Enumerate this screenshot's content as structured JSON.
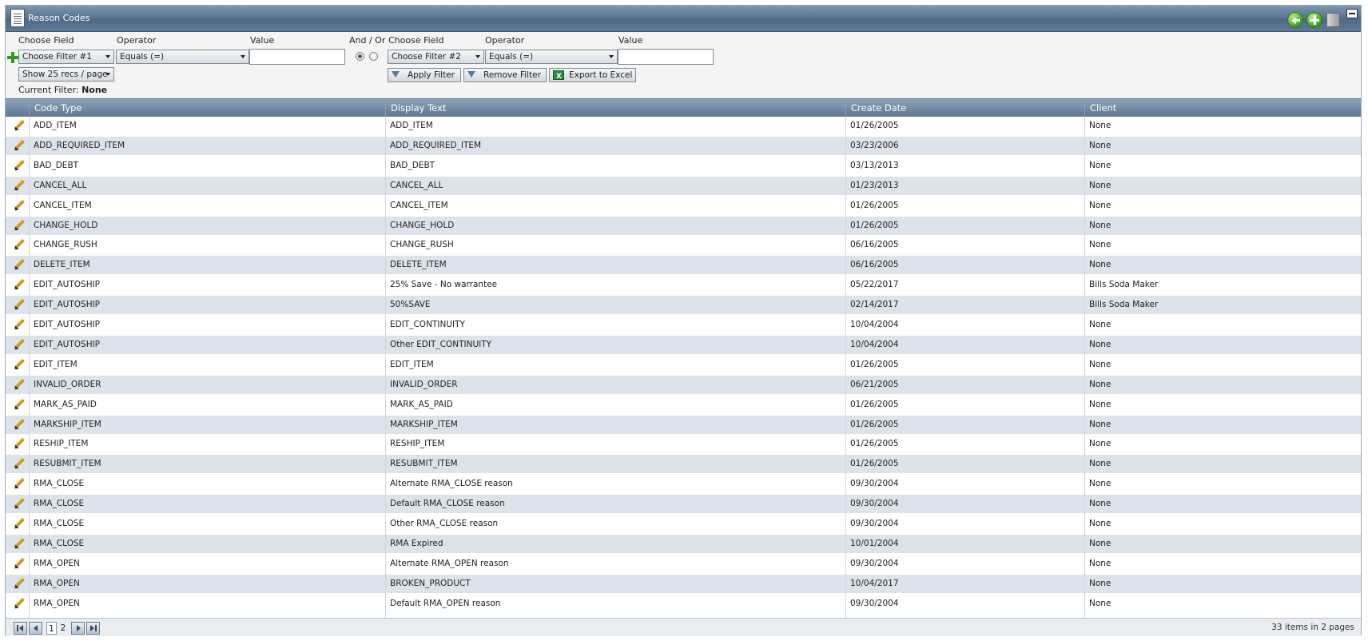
{
  "window": {
    "title": "Reason Codes"
  },
  "filter": {
    "choose_field_label": "Choose Field",
    "operator_label": "Operator",
    "value_label": "Value",
    "and_or_label": "And / Or",
    "filter1": "Choose Filter #1",
    "operator1": "Equals (=)",
    "filter2": "Choose Filter #2",
    "operator2": "Equals (=)",
    "page_size": "Show 25 recs / page",
    "current_filter_label": "Current Filter:",
    "current_filter_value": "None",
    "apply_label": "Apply Filter",
    "remove_label": "Remove Filter",
    "export_label": "Export to Excel"
  },
  "table": {
    "columns": [
      "Code Type",
      "Display Text",
      "Create Date",
      "Client"
    ],
    "rows": [
      [
        "ADD_ITEM",
        "ADD_ITEM",
        "01/26/2005",
        "None"
      ],
      [
        "ADD_REQUIRED_ITEM",
        "ADD_REQUIRED_ITEM",
        "03/23/2006",
        "None"
      ],
      [
        "BAD_DEBT",
        "BAD_DEBT",
        "03/13/2013",
        "None"
      ],
      [
        "CANCEL_ALL",
        "CANCEL_ALL",
        "01/23/2013",
        "None"
      ],
      [
        "CANCEL_ITEM",
        "CANCEL_ITEM",
        "01/26/2005",
        "None"
      ],
      [
        "CHANGE_HOLD",
        "CHANGE_HOLD",
        "01/26/2005",
        "None"
      ],
      [
        "CHANGE_RUSH",
        "CHANGE_RUSH",
        "06/16/2005",
        "None"
      ],
      [
        "DELETE_ITEM",
        "DELETE_ITEM",
        "06/16/2005",
        "None"
      ],
      [
        "EDIT_AUTOSHIP",
        "25% Save - No warrantee",
        "05/22/2017",
        "Bills Soda Maker"
      ],
      [
        "EDIT_AUTOSHIP",
        "50%SAVE",
        "02/14/2017",
        "Bills Soda Maker"
      ],
      [
        "EDIT_AUTOSHIP",
        "EDIT_CONTINUITY",
        "10/04/2004",
        "None"
      ],
      [
        "EDIT_AUTOSHIP",
        "Other EDIT_CONTINUITY",
        "10/04/2004",
        "None"
      ],
      [
        "EDIT_ITEM",
        "EDIT_ITEM",
        "01/26/2005",
        "None"
      ],
      [
        "INVALID_ORDER",
        "INVALID_ORDER",
        "06/21/2005",
        "None"
      ],
      [
        "MARK_AS_PAID",
        "MARK_AS_PAID",
        "01/26/2005",
        "None"
      ],
      [
        "MARKSHIP_ITEM",
        "MARKSHIP_ITEM",
        "01/26/2005",
        "None"
      ],
      [
        "RESHIP_ITEM",
        "RESHIP_ITEM",
        "01/26/2005",
        "None"
      ],
      [
        "RESUBMIT_ITEM",
        "RESUBMIT_ITEM",
        "01/26/2005",
        "None"
      ],
      [
        "RMA_CLOSE",
        "Alternate RMA_CLOSE reason",
        "09/30/2004",
        "None"
      ],
      [
        "RMA_CLOSE",
        "Default RMA_CLOSE reason",
        "09/30/2004",
        "None"
      ],
      [
        "RMA_CLOSE",
        "Other RMA_CLOSE reason",
        "09/30/2004",
        "None"
      ],
      [
        "RMA_CLOSE",
        "RMA Expired",
        "10/01/2004",
        "None"
      ],
      [
        "RMA_OPEN",
        "Alternate RMA_OPEN reason",
        "09/30/2004",
        "None"
      ],
      [
        "RMA_OPEN",
        "BROKEN_PRODUCT",
        "10/04/2017",
        "None"
      ],
      [
        "RMA_OPEN",
        "Default RMA_OPEN reason",
        "09/30/2004",
        "None"
      ]
    ]
  },
  "pager": {
    "pages": [
      "1",
      "2"
    ],
    "current_page": "1",
    "info": "33 items in 2 pages"
  },
  "icons": {
    "back": "back-arrow-icon",
    "add": "add-icon",
    "cube": "cube-icon",
    "minimize": "minimize-icon",
    "edit": "pencil-icon"
  },
  "colors": {
    "header": "#5d7893",
    "alt_row": "#dde3ea",
    "green": "#3c9c1f"
  }
}
